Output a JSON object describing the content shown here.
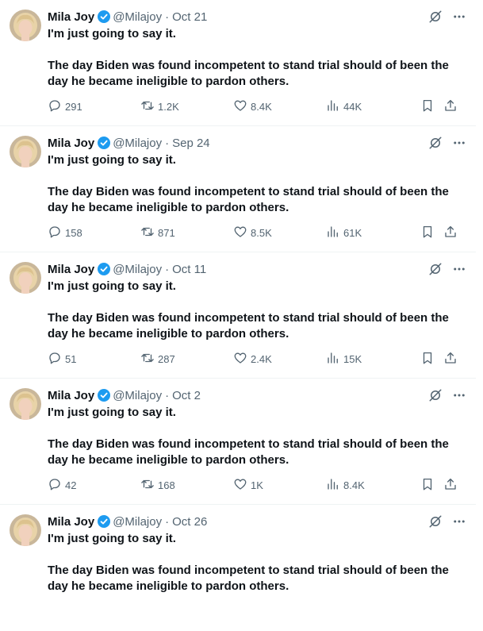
{
  "tweets": [
    {
      "author": {
        "name": "Mila Joy",
        "handle": "@Milajoy",
        "verified": true
      },
      "date": "Oct 21",
      "text": {
        "line1": "I'm just going to say it.",
        "line2": "The day Biden was found incompetent to stand trial should of been the day he became ineligible to pardon others."
      },
      "stats": {
        "replies": "291",
        "retweets": "1.2K",
        "likes": "8.4K",
        "views": "44K"
      }
    },
    {
      "author": {
        "name": "Mila Joy",
        "handle": "@Milajoy",
        "verified": true
      },
      "date": "Sep 24",
      "text": {
        "line1": "I'm just going to say it.",
        "line2": "The day Biden was found incompetent to stand trial should of been the day he became ineligible to pardon others."
      },
      "stats": {
        "replies": "158",
        "retweets": "871",
        "likes": "8.5K",
        "views": "61K"
      }
    },
    {
      "author": {
        "name": "Mila Joy",
        "handle": "@Milajoy",
        "verified": true
      },
      "date": "Oct 11",
      "text": {
        "line1": "I'm just going to say it.",
        "line2": "The day Biden was found incompetent to stand trial should of been the day he became ineligible to pardon others."
      },
      "stats": {
        "replies": "51",
        "retweets": "287",
        "likes": "2.4K",
        "views": "15K"
      }
    },
    {
      "author": {
        "name": "Mila Joy",
        "handle": "@Milajoy",
        "verified": true
      },
      "date": "Oct 2",
      "text": {
        "line1": "I'm just going to say it.",
        "line2": "The day Biden was found incompetent to stand trial should of been the day he became ineligible to pardon others."
      },
      "stats": {
        "replies": "42",
        "retweets": "168",
        "likes": "1K",
        "views": "8.4K"
      }
    },
    {
      "author": {
        "name": "Mila Joy",
        "handle": "@Milajoy",
        "verified": true
      },
      "date": "Oct 26",
      "text": {
        "line1": "I'm just going to say it.",
        "line2": "The day Biden was found incompetent to stand trial should of been the day he became ineligible to pardon others."
      },
      "stats": null
    }
  ],
  "separator": "·",
  "colors": {
    "text": "#0f1419",
    "muted": "#536471",
    "verified": "#1d9bf0",
    "border": "#eff3f4"
  },
  "icons": [
    "verified-badge-icon",
    "grok-icon",
    "more-icon",
    "reply-icon",
    "retweet-icon",
    "like-icon",
    "views-icon",
    "bookmark-icon",
    "share-icon"
  ]
}
